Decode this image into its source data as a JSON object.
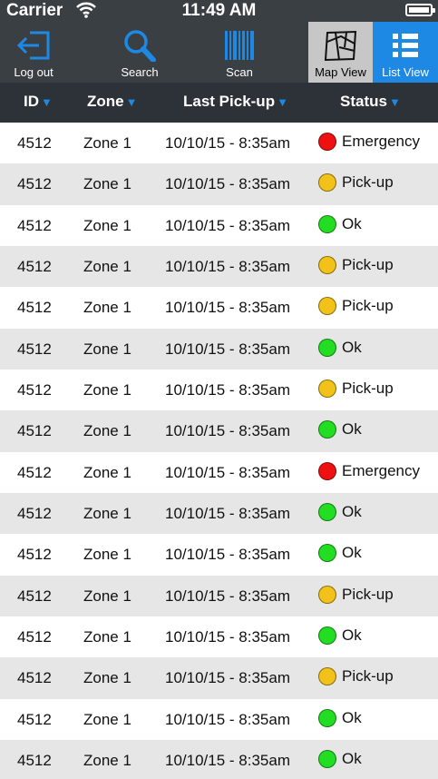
{
  "statusbar": {
    "carrier": "Carrier",
    "time": "11:49 AM"
  },
  "toolbar": {
    "logout_label": "Log out",
    "search_label": "Search",
    "scan_label": "Scan",
    "mapview_label": "Map View",
    "listview_label": "List View"
  },
  "table": {
    "headers": {
      "id": "ID",
      "zone": "Zone",
      "last_pickup": "Last Pick-up",
      "status": "Status"
    },
    "status_colors": {
      "Emergency": "#ee1111",
      "Pick-up": "#f2c21a",
      "Ok": "#22dd22"
    },
    "rows": [
      {
        "id": "4512",
        "zone": "Zone 1",
        "last_pickup": "10/10/15 - 8:35am",
        "status": "Emergency"
      },
      {
        "id": "4512",
        "zone": "Zone 1",
        "last_pickup": "10/10/15 - 8:35am",
        "status": "Pick-up"
      },
      {
        "id": "4512",
        "zone": "Zone 1",
        "last_pickup": "10/10/15 - 8:35am",
        "status": "Ok"
      },
      {
        "id": "4512",
        "zone": "Zone 1",
        "last_pickup": "10/10/15 - 8:35am",
        "status": "Pick-up"
      },
      {
        "id": "4512",
        "zone": "Zone 1",
        "last_pickup": "10/10/15 - 8:35am",
        "status": "Pick-up"
      },
      {
        "id": "4512",
        "zone": "Zone 1",
        "last_pickup": "10/10/15 - 8:35am",
        "status": "Ok"
      },
      {
        "id": "4512",
        "zone": "Zone 1",
        "last_pickup": "10/10/15 - 8:35am",
        "status": "Pick-up"
      },
      {
        "id": "4512",
        "zone": "Zone 1",
        "last_pickup": "10/10/15 - 8:35am",
        "status": "Ok"
      },
      {
        "id": "4512",
        "zone": "Zone 1",
        "last_pickup": "10/10/15 - 8:35am",
        "status": "Emergency"
      },
      {
        "id": "4512",
        "zone": "Zone 1",
        "last_pickup": "10/10/15 - 8:35am",
        "status": "Ok"
      },
      {
        "id": "4512",
        "zone": "Zone 1",
        "last_pickup": "10/10/15 - 8:35am",
        "status": "Ok"
      },
      {
        "id": "4512",
        "zone": "Zone 1",
        "last_pickup": "10/10/15 - 8:35am",
        "status": "Pick-up"
      },
      {
        "id": "4512",
        "zone": "Zone 1",
        "last_pickup": "10/10/15 - 8:35am",
        "status": "Ok"
      },
      {
        "id": "4512",
        "zone": "Zone 1",
        "last_pickup": "10/10/15 - 8:35am",
        "status": "Pick-up"
      },
      {
        "id": "4512",
        "zone": "Zone 1",
        "last_pickup": "10/10/15 - 8:35am",
        "status": "Ok"
      },
      {
        "id": "4512",
        "zone": "Zone 1",
        "last_pickup": "10/10/15 - 8:35am",
        "status": "Ok"
      }
    ]
  }
}
